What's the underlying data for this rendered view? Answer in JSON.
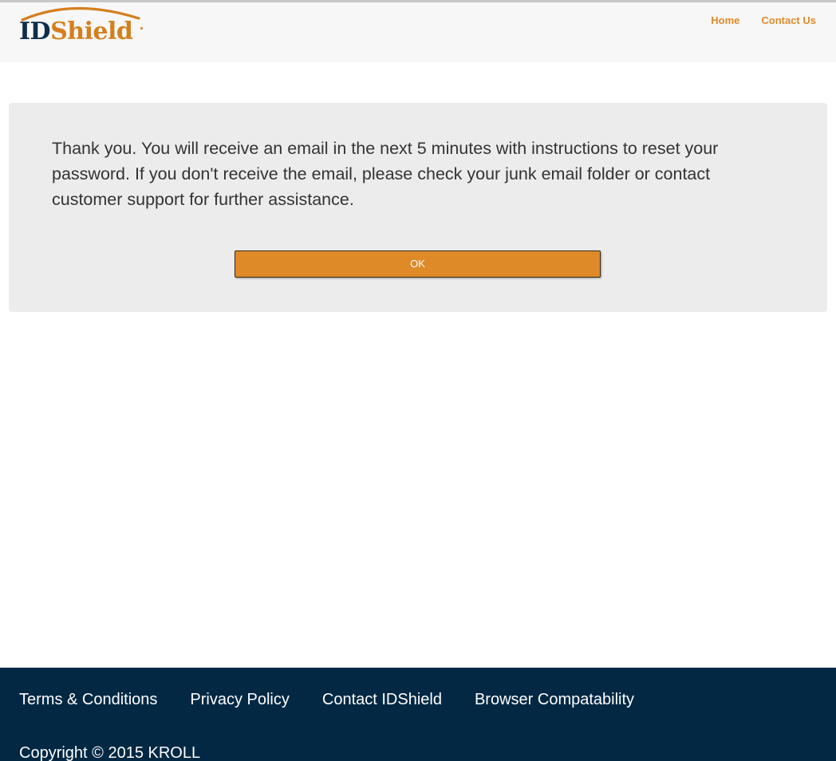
{
  "header": {
    "logo": {
      "part1": "ID",
      "part2": "Shield"
    },
    "nav": [
      {
        "label": "Home"
      },
      {
        "label": "Contact Us"
      }
    ]
  },
  "main": {
    "message": "Thank you. You will receive an email in the next 5 minutes with instructions to reset your password. If you don't receive the email, please check your junk email folder or contact customer support for further assistance.",
    "ok_label": "OK"
  },
  "footer": {
    "links": [
      {
        "label": "Terms & Conditions"
      },
      {
        "label": "Privacy Policy"
      },
      {
        "label": "Contact IDShield"
      },
      {
        "label": "Browser Compatability"
      }
    ],
    "copyright": "Copyright © 2015 KROLL"
  },
  "colors": {
    "brand_orange": "#de8a28",
    "brand_navy": "#022843",
    "panel_bg": "#ececec"
  }
}
